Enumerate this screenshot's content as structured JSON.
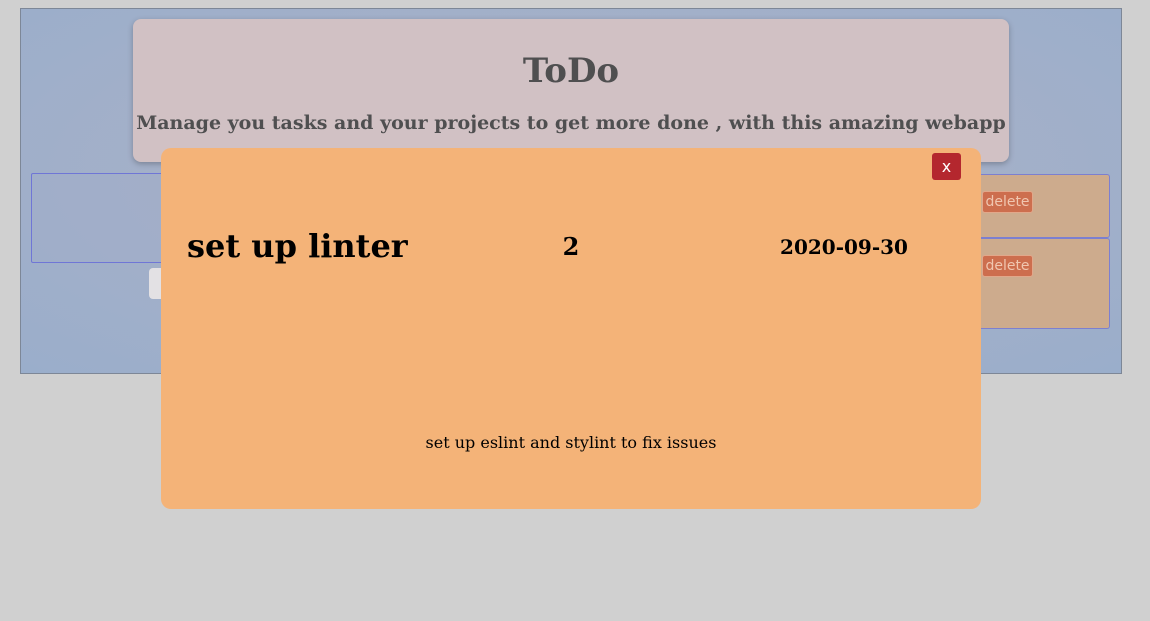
{
  "header": {
    "title": "ToDo",
    "subtitle": "Manage you tasks and your projects to get more done , with this amazing webapp"
  },
  "task_list": {
    "rows": [
      {
        "delete_label": "delete"
      },
      {
        "delete_label": "delete"
      }
    ]
  },
  "modal": {
    "close_label": "x",
    "task_title": "set up linter",
    "priority": "2",
    "due_date": "2020-09-30",
    "description": "set up eslint and stylint to fix issues"
  },
  "colors": {
    "page_background": "#d0d0d0",
    "modal_background": "#f4b378",
    "close_button": "#b4272e",
    "delete_button": "#cd6e4e",
    "header_card": "#d1c1c4"
  }
}
